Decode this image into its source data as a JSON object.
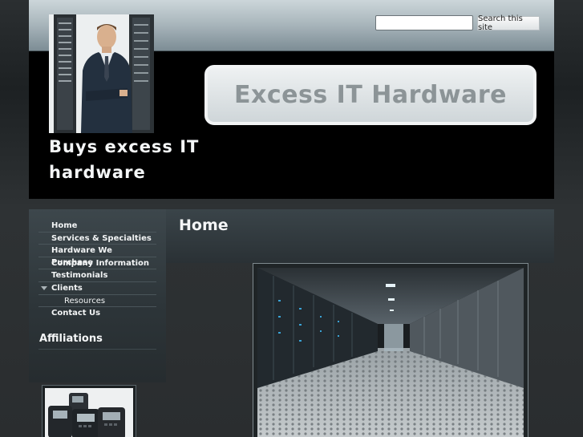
{
  "search": {
    "placeholder": "",
    "value": "",
    "button_label": "Search this site"
  },
  "header": {
    "logo_text": "Excess IT Hardware",
    "tagline_line1": "Buys excess IT",
    "tagline_line2": "hardware"
  },
  "nav": {
    "items": [
      {
        "label": "Home"
      },
      {
        "label": "Services & Specialties"
      },
      {
        "label": "Hardware We Purchase"
      },
      {
        "label": "Company Information"
      },
      {
        "label": "Testimonials"
      },
      {
        "label": "Clients",
        "expanded": true
      },
      {
        "label": "Resources",
        "sub": true
      },
      {
        "label": "Contact Us"
      }
    ]
  },
  "sidebar": {
    "affiliations_heading": "Affiliations"
  },
  "main": {
    "page_title": "Home"
  },
  "colors": {
    "header_band_top": "#ccd6da",
    "header_band_bottom": "#7e8e96",
    "header_bg": "#000000",
    "logo_text": "#8c9497",
    "panel_bg": "#3d474c",
    "text_light": "#f4f6f7"
  },
  "icons": {
    "submenu_arrow": "triangle-down-icon"
  }
}
